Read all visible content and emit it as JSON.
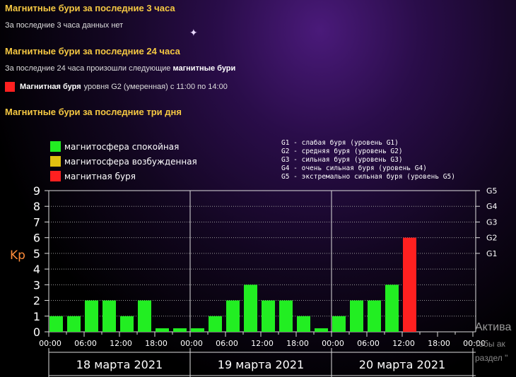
{
  "sections": {
    "h3": "Магнитные бури за последние 3 часа",
    "h3_text": "За последние 3 часа данных нет",
    "h24": "Магнитные бури за последние 24 часа",
    "h24_text": "За последние 24 часа произошли следующие",
    "h24_text_bold": "магнитные бури",
    "storm_bold": "Магнитная буря",
    "storm_text": "уровня G2 (умеренная) с 11:00 по 14:00",
    "h3days": "Магнитные бури за последние три дня"
  },
  "legend": {
    "calm": "магнитосфера спокойная",
    "excited": "магнитосфера возбужденная",
    "storm": "магнитная буря"
  },
  "glegend": {
    "g1": "G1 - слабая буря (уровень G1)",
    "g2": "G2 - средняя буря (уровень G2)",
    "g3": "G3 - сильная буря (уровень G3)",
    "g4": "G4 - очень сильная буря (уровень G4)",
    "g5": "G5 - экстремально сильная буря (уровень G5)"
  },
  "colors": {
    "calm": "#22ee22",
    "excited": "#e0c010",
    "storm": "#ff2020",
    "heading": "#f5c842",
    "kp_label": "#ff8c3a"
  },
  "watermark": {
    "line1": "Актива",
    "line2": "тобы ак",
    "line3": "раздел \""
  },
  "chart_data": {
    "type": "bar",
    "ylabel": "Kp",
    "ylim": [
      0,
      9
    ],
    "yticks": [
      "0",
      "1",
      "2",
      "3",
      "4",
      "5",
      "6",
      "7",
      "8",
      "9"
    ],
    "g_ticks": [
      {
        "kp": 5,
        "label": "G1"
      },
      {
        "kp": 6,
        "label": "G2"
      },
      {
        "kp": 7,
        "label": "G3"
      },
      {
        "kp": 8,
        "label": "G4"
      },
      {
        "kp": 9,
        "label": "G5"
      }
    ],
    "days": [
      "18 марта 2021",
      "19 марта 2021",
      "20 марта 2021"
    ],
    "time_ticks": [
      "00:00",
      "06:00",
      "12:00",
      "18:00",
      "00:00",
      "06:00",
      "12:00",
      "18:00",
      "00:00",
      "06:00",
      "12:00",
      "18:00",
      "00:00"
    ],
    "values": [
      1,
      1,
      2,
      2,
      1,
      2,
      0,
      0,
      0,
      1,
      2,
      3,
      2,
      2,
      1,
      0,
      1,
      2,
      2,
      3,
      6
    ],
    "levels": [
      "calm",
      "calm",
      "calm",
      "calm",
      "calm",
      "calm",
      "calm",
      "calm",
      "calm",
      "calm",
      "calm",
      "calm",
      "calm",
      "calm",
      "calm",
      "calm",
      "calm",
      "calm",
      "calm",
      "calm",
      "storm"
    ]
  }
}
